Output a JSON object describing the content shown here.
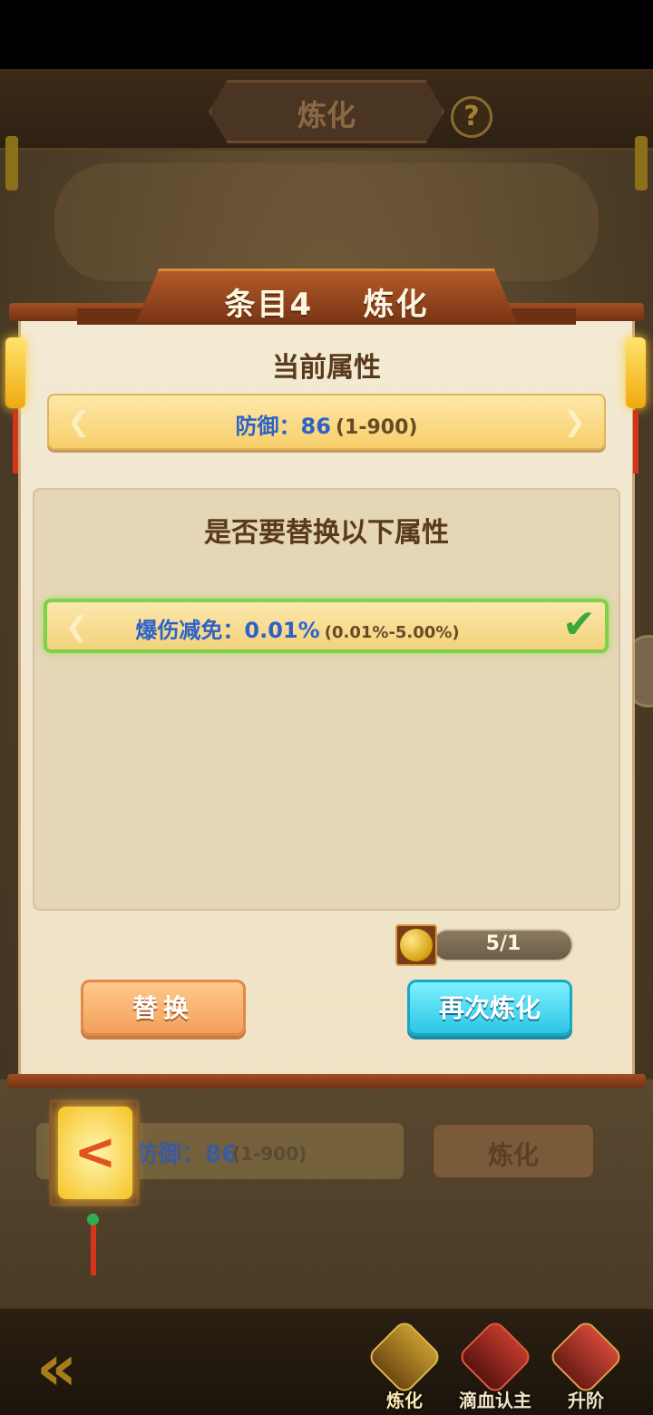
{
  "background": {
    "screen_title": "炼化",
    "help_symbol": "?",
    "current_row": {
      "name": "防御：",
      "value": "86",
      "range": "(1-900)"
    },
    "refine_button": "炼化",
    "back_arrow": "<"
  },
  "dialog": {
    "title": "条目4    炼化",
    "current_attr_title": "当前属性",
    "current_attr": {
      "name": "防御：",
      "value": "86",
      "range": "(1-900)"
    },
    "replace_question": "是否要替换以下属性",
    "option": {
      "name": "爆伤减免：",
      "value": "0.01%",
      "range": "(0.01%-5.00%)",
      "selected": true
    },
    "cost": {
      "icon": "gold-coin-icon",
      "text": "5/1"
    },
    "replace_button": "替换",
    "refine_again_button": "再次炼化"
  },
  "bottom_nav": {
    "back_symbol": "«",
    "items": [
      {
        "label": "炼化",
        "icon": "furnace-icon",
        "active": true
      },
      {
        "label": "滴血认主",
        "icon": "blood-drop-icon",
        "active": false
      },
      {
        "label": "升阶",
        "icon": "upgrade-icon",
        "active": false
      }
    ]
  },
  "colors": {
    "accent_blue": "#2d63c9",
    "select_green": "#7fd04a",
    "button_cyan": "#2cc6e6",
    "button_orange": "#f2a05c"
  }
}
